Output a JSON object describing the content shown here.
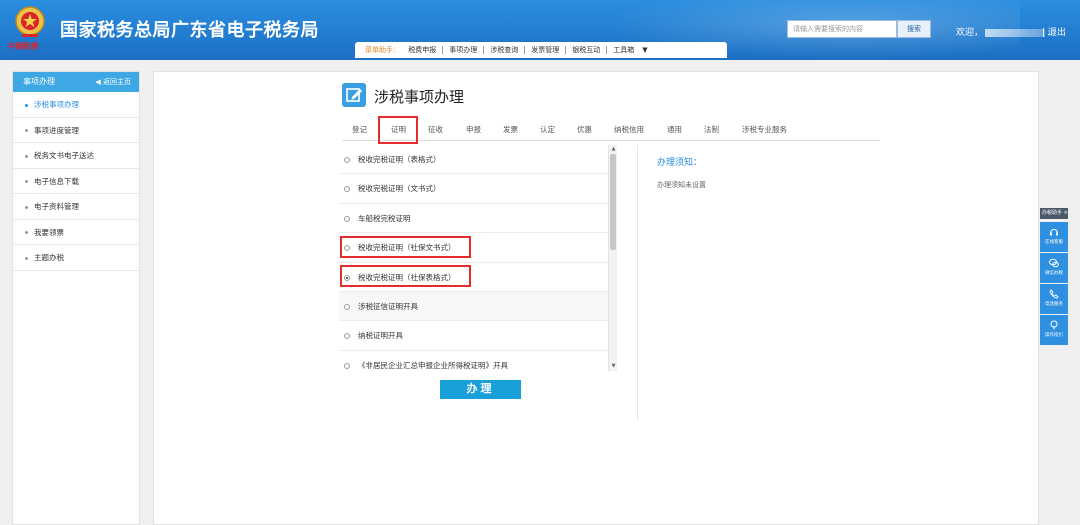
{
  "header": {
    "emblem_motto": "中國稅務",
    "title": "国家税务总局广东省电子税务局",
    "search_placeholder": "请输入需要搜索的内容",
    "search_button": "搜索",
    "welcome": "欢迎，",
    "welcome_suffix": "...",
    "logout": "退出"
  },
  "menu": {
    "lead": "菜单助手：",
    "items": [
      "税费申报",
      "事项办理",
      "涉税查询",
      "发票管理",
      "银税互动",
      "工具箱"
    ]
  },
  "sidebar": {
    "title": "事项办理",
    "back": "返回主页",
    "items": [
      "涉税事项办理",
      "事项进度管理",
      "税务文书电子送达",
      "电子信息下载",
      "电子资料管理",
      "我要领票",
      "主题办税"
    ],
    "active_index": 0
  },
  "page": {
    "title": "涉税事项办理",
    "tabs": [
      "登记",
      "证明",
      "征收",
      "申报",
      "发票",
      "认定",
      "优惠",
      "纳税信用",
      "通用",
      "法制",
      "涉税专业服务"
    ],
    "active_tab": 1
  },
  "options": [
    {
      "label": "税收完税证明（表格式）",
      "checked": false
    },
    {
      "label": "税收完税证明（文书式）",
      "checked": false
    },
    {
      "label": "车船税完税证明",
      "checked": false
    },
    {
      "label": "税收完税证明（社保文书式）",
      "checked": false
    },
    {
      "label": "税收完税证明（社保表格式）",
      "checked": true
    },
    {
      "label": "涉税征信证明开具",
      "checked": false
    },
    {
      "label": "纳税证明开具",
      "checked": false
    },
    {
      "label": "《非居民企业汇总申报企业所得税证明》开具",
      "checked": false
    }
  ],
  "submit_label": "办理",
  "notice": {
    "title": "办理须知：",
    "text": "办理须知未设置"
  },
  "float_panel": {
    "title": "办税助手",
    "close": "×",
    "buttons": [
      "在线客服",
      "微信办税",
      "电话服务",
      "操作指引"
    ]
  },
  "colors": {
    "header_blue": "#1c6fc4",
    "accent": "#2b8ee0",
    "highlight_red": "#e52b2b",
    "button": "#1aa0d8"
  }
}
